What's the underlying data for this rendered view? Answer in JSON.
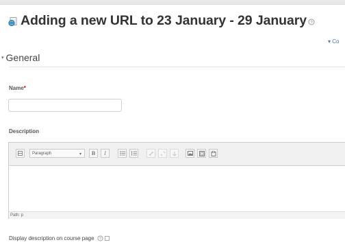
{
  "page": {
    "title": "Adding a new URL to 23 January - 29 January",
    "collapse_link": "▾ Co"
  },
  "section": {
    "label": "General",
    "arrow": "▾"
  },
  "form": {
    "name_label": "Name",
    "required_mark": "*",
    "name_value": "",
    "description_label": "Description",
    "format_select": "Paragraph",
    "path_text": "Path: p",
    "display_label": "Display description on course page"
  },
  "toolbar": {
    "bold": "B",
    "italic": "I"
  },
  "colors": {
    "link": "#4a78b0",
    "required": "#cc0000"
  }
}
